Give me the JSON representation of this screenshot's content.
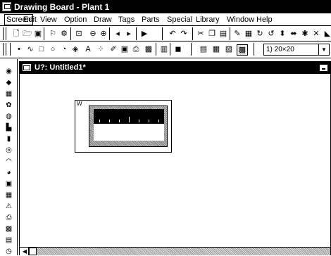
{
  "app": {
    "title": "Drawing Board - Plant 1"
  },
  "menu": [
    {
      "label": "Screen",
      "active": true
    },
    {
      "label": "Edit"
    },
    {
      "label": "View"
    },
    {
      "label": "Option"
    },
    {
      "label": "Draw"
    },
    {
      "label": "Tags"
    },
    {
      "label": "Parts"
    },
    {
      "label": "Special"
    },
    {
      "label": "Library"
    },
    {
      "label": "Window"
    },
    {
      "label": "Help"
    }
  ],
  "toolbar1": {
    "icons": [
      "new-icon",
      "open-icon",
      "save-icon",
      "tag-icon",
      "part-icon",
      "zoom-fit-icon",
      "zoom-out-icon",
      "zoom-in-icon",
      "prev-icon",
      "next-icon",
      "run-icon",
      "undo-icon",
      "redo-icon",
      "cut-icon",
      "copy-icon",
      "paste-icon",
      "erase-icon",
      "group-icon",
      "rotate-icon",
      "rotate-ccw-icon",
      "flip-v-icon",
      "flip-h-icon",
      "align-icon",
      "arrange-icon",
      "fill-icon"
    ]
  },
  "toolbar2": {
    "grid_select": {
      "value": "1) 20×20"
    },
    "icons": [
      "point-icon",
      "polyline-icon",
      "rectangle-icon",
      "circle-icon",
      "arc-icon",
      "fill-pattern-icon",
      "text-icon",
      "dots-icon",
      "pen-icon",
      "image-icon",
      "print-icon",
      "bitmap-icon",
      "library-icon",
      "parts-icon",
      "layer1-icon",
      "layer2-icon",
      "layer3-icon",
      "layer4-icon"
    ]
  },
  "palette": {
    "icons": [
      "lamp-icon",
      "switch-icon",
      "keypad-icon",
      "selector-icon",
      "meter-icon",
      "trend-icon",
      "bar-graph-icon",
      "circle-graph-icon",
      "half-circle-icon",
      "pie-icon",
      "graph-icon",
      "table-icon",
      "alarm-icon",
      "printer-icon",
      "grid-icon",
      "calendar-icon",
      "clock-icon"
    ]
  },
  "child": {
    "title": "U?: Untitled1*",
    "part_label": "W"
  }
}
